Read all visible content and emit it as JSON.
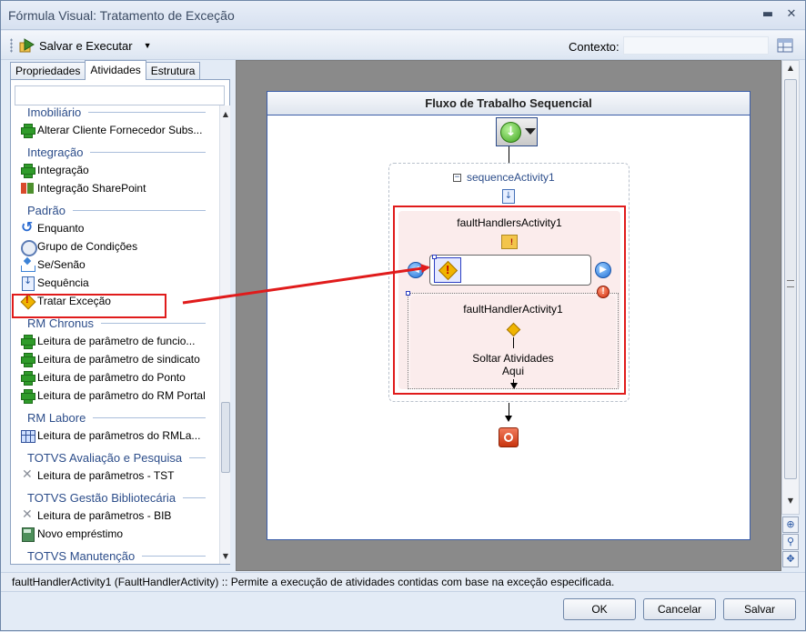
{
  "window": {
    "title": "Fórmula Visual: Tratamento de Exceção",
    "minimize_glyph": "▬",
    "close_glyph": "✕"
  },
  "toolbar": {
    "save_execute_label": "Salvar e Executar",
    "contexto_label": "Contexto:",
    "contexto_value": ""
  },
  "left_tabs": [
    {
      "label": "Propriedades",
      "active": false
    },
    {
      "label": "Atividades",
      "active": true
    },
    {
      "label": "Estrutura",
      "active": false
    }
  ],
  "toolbox": {
    "search_value": "",
    "entries": [
      {
        "kind": "category",
        "label": "Imobiliário"
      },
      {
        "kind": "item",
        "label": "Alterar Cliente Fornecedor Subs...",
        "icon": "green-cross-icon"
      },
      {
        "kind": "category",
        "label": "Integração"
      },
      {
        "kind": "item",
        "label": "Integração",
        "icon": "green-cross-icon"
      },
      {
        "kind": "item",
        "label": "Integração SharePoint",
        "icon": "sharepoint-icon"
      },
      {
        "kind": "category",
        "label": "Padrão"
      },
      {
        "kind": "item",
        "label": "Enquanto",
        "icon": "loop-icon"
      },
      {
        "kind": "item",
        "label": "Grupo de Condições",
        "icon": "condition-group-icon"
      },
      {
        "kind": "item",
        "label": "Se/Senão",
        "icon": "if-else-icon"
      },
      {
        "kind": "item",
        "label": "Sequência",
        "icon": "sequence-icon"
      },
      {
        "kind": "item",
        "label": "Tratar Exceção",
        "icon": "exception-icon"
      },
      {
        "kind": "category",
        "label": "RM Chronus"
      },
      {
        "kind": "item",
        "label": "Leitura de parâmetro de funcio...",
        "icon": "green-cross-icon"
      },
      {
        "kind": "item",
        "label": "Leitura de parâmetro de sindicato",
        "icon": "green-cross-icon"
      },
      {
        "kind": "item",
        "label": "Leitura de parâmetro do Ponto",
        "icon": "green-cross-icon"
      },
      {
        "kind": "item",
        "label": "Leitura de parâmetro do RM Portal",
        "icon": "green-cross-icon"
      },
      {
        "kind": "category",
        "label": "RM Labore"
      },
      {
        "kind": "item",
        "label": "Leitura de parâmetros do RMLa...",
        "icon": "grid-icon"
      },
      {
        "kind": "category",
        "label": "TOTVS Avaliação e Pesquisa"
      },
      {
        "kind": "item",
        "label": "Leitura de parâmetros - TST",
        "icon": "tools-icon"
      },
      {
        "kind": "category",
        "label": "TOTVS Gestão Bibliotecária"
      },
      {
        "kind": "item",
        "label": "Leitura de parâmetros - BIB",
        "icon": "tools-icon"
      },
      {
        "kind": "item",
        "label": "Novo empréstimo",
        "icon": "book-icon"
      },
      {
        "kind": "category",
        "label": "TOTVS Manutenção"
      }
    ]
  },
  "designer": {
    "workflow_title": "Fluxo de Trabalho Sequencial",
    "sequence_title": "sequenceActivity1",
    "fault_handlers_title": "faultHandlersActivity1",
    "fault_handler_title": "faultHandlerActivity1",
    "drop_text_line1": "Soltar Atividades",
    "drop_text_line2": "Aqui",
    "collapse_glyph": "−",
    "start_glyph": "↓",
    "prev_glyph": "◀",
    "next_glyph": "▶",
    "error_glyph": "!"
  },
  "side_tools": [
    "⊕",
    "⚲",
    "✥"
  ],
  "statusbar": {
    "text": "faultHandlerActivity1  (FaultHandlerActivity)  :: Permite a execução de atividades contidas com base na exceção especificada."
  },
  "buttons": {
    "ok": "OK",
    "cancel": "Cancelar",
    "save": "Salvar"
  },
  "colors": {
    "annotation_red": "#e01b1b",
    "category_blue": "#2c4d8a",
    "workflow_border": "#3b5da8"
  }
}
